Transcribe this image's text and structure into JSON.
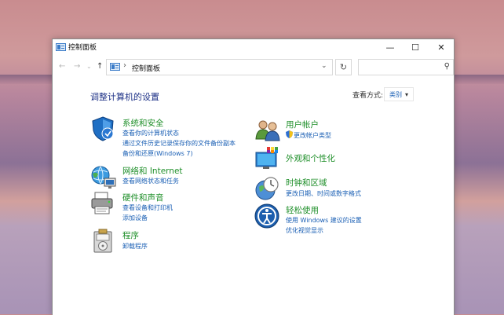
{
  "window": {
    "title": "控制面板",
    "minimize_glyph": "—",
    "maximize_glyph": "☐",
    "close_glyph": "✕"
  },
  "nav": {
    "back_glyph": "←",
    "forward_glyph": "→",
    "recent_glyph": "⌄",
    "up_glyph": "↑",
    "breadcrumb_sep": "›",
    "address_text": "控制面板",
    "address_drop_glyph": "⌄",
    "refresh_glyph": "↻",
    "search_placeholder": "",
    "search_glyph": "⚲"
  },
  "main": {
    "heading": "调整计算机的设置",
    "view_by_label": "查看方式:",
    "view_by_value": "类别",
    "view_by_arrow": "▾"
  },
  "categories_left": [
    {
      "icon": "shield-icon",
      "title": "系统和安全",
      "links": [
        "查看你的计算机状态",
        "通过文件历史记录保存你的文件备份副本",
        "备份和还原(Windows 7)"
      ]
    },
    {
      "icon": "network-globe-icon",
      "title": "网络和 Internet",
      "links": [
        "查看网络状态和任务"
      ]
    },
    {
      "icon": "printer-icon",
      "title": "硬件和声音",
      "links": [
        "查看设备和打印机",
        "添加设备"
      ]
    },
    {
      "icon": "programs-icon",
      "title": "程序",
      "links": [
        "卸载程序"
      ]
    }
  ],
  "categories_right": [
    {
      "icon": "users-icon",
      "title": "用户帐户",
      "links": [
        "更改帐户类型"
      ]
    },
    {
      "icon": "appearance-icon",
      "title": "外观和个性化",
      "links": []
    },
    {
      "icon": "clock-globe-icon",
      "title": "时钟和区域",
      "links": [
        "更改日期、时间或数字格式"
      ]
    },
    {
      "icon": "accessibility-icon",
      "title": "轻松使用",
      "links": [
        "使用 Windows 建议的设置",
        "优化视觉显示"
      ]
    }
  ],
  "colors": {
    "category_title": "#1f8f2a",
    "link": "#1a5fb4",
    "heading": "#1e3287"
  }
}
